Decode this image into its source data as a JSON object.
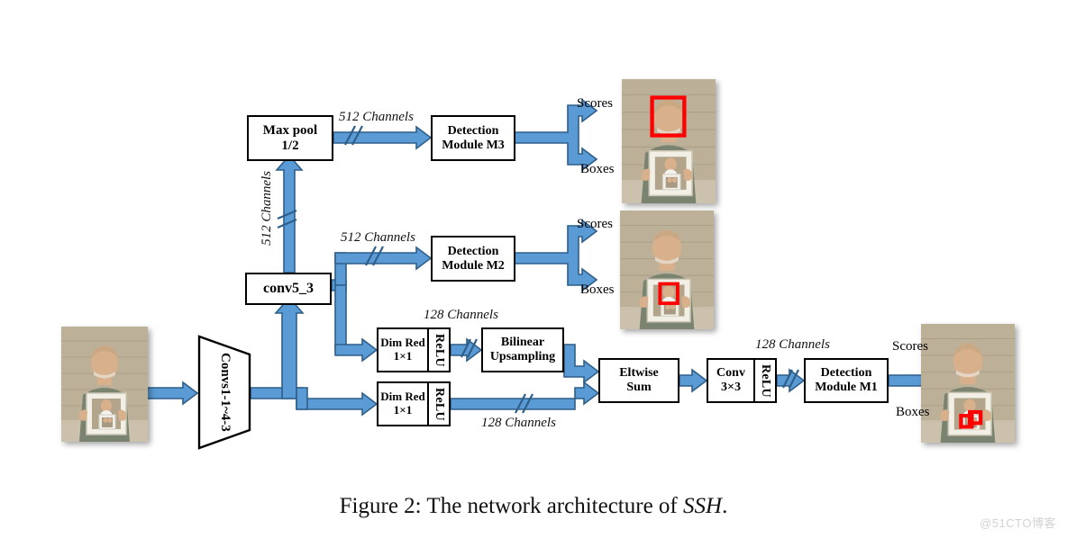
{
  "figure": {
    "caption_prefix": "Figure 2: The network architecture of ",
    "caption_italic": "SSH",
    "caption_suffix": ".",
    "watermark": "@51CTO博客"
  },
  "colors": {
    "arrow_fill": "#5B9BD5",
    "arrow_stroke": "#2E5F8A",
    "box_border": "#000000",
    "detection_box": "#FF0000",
    "background": "#FFFFFF"
  },
  "blocks": {
    "convs": {
      "line1": "Convs",
      "line2": "1-1~4-3"
    },
    "conv5_3": {
      "label": "conv5_3"
    },
    "maxpool": {
      "line1": "Max pool",
      "line2": "1/2"
    },
    "det_m3": {
      "line1": "Detection",
      "line2": "Module M3"
    },
    "det_m2": {
      "line1": "Detection",
      "line2": "Module M2"
    },
    "det_m1": {
      "line1": "Detection",
      "line2": "Module M1"
    },
    "dimred_top": {
      "line1": "Dim Red",
      "line2": "1×1",
      "relu": "ReLU"
    },
    "dimred_bot": {
      "line1": "Dim Red",
      "line2": "1×1",
      "relu": "ReLU"
    },
    "bilinear": {
      "line1": "Bilinear",
      "line2": "Upsampling"
    },
    "eltwise": {
      "line1": "Eltwise",
      "line2": "Sum"
    },
    "conv3x3": {
      "line1": "Conv",
      "line2": "3×3",
      "relu": "ReLU"
    }
  },
  "channel_labels": {
    "maxpool_to_m3": "512 Channels",
    "conv53_to_maxpool": "512 Channels",
    "conv53_to_m2": "512 Channels",
    "dimred_top_out": "128 Channels",
    "dimred_bot_out": "128 Channels",
    "conv3x3_to_m1": "128 Channels"
  },
  "outputs": [
    {
      "scores": "Scores",
      "boxes": "Boxes"
    },
    {
      "scores": "Scores",
      "boxes": "Boxes"
    },
    {
      "scores": "Scores",
      "boxes": "Boxes"
    }
  ],
  "photos": {
    "input": {
      "name": "input-image",
      "detections": []
    },
    "m3": {
      "name": "m3-output-image",
      "detections": [
        "large-face-box"
      ]
    },
    "m2": {
      "name": "m2-output-image",
      "detections": [
        "medium-face-box"
      ]
    },
    "m1": {
      "name": "m1-output-image",
      "detections": [
        "small-face-box-a",
        "small-face-box-b"
      ]
    }
  }
}
